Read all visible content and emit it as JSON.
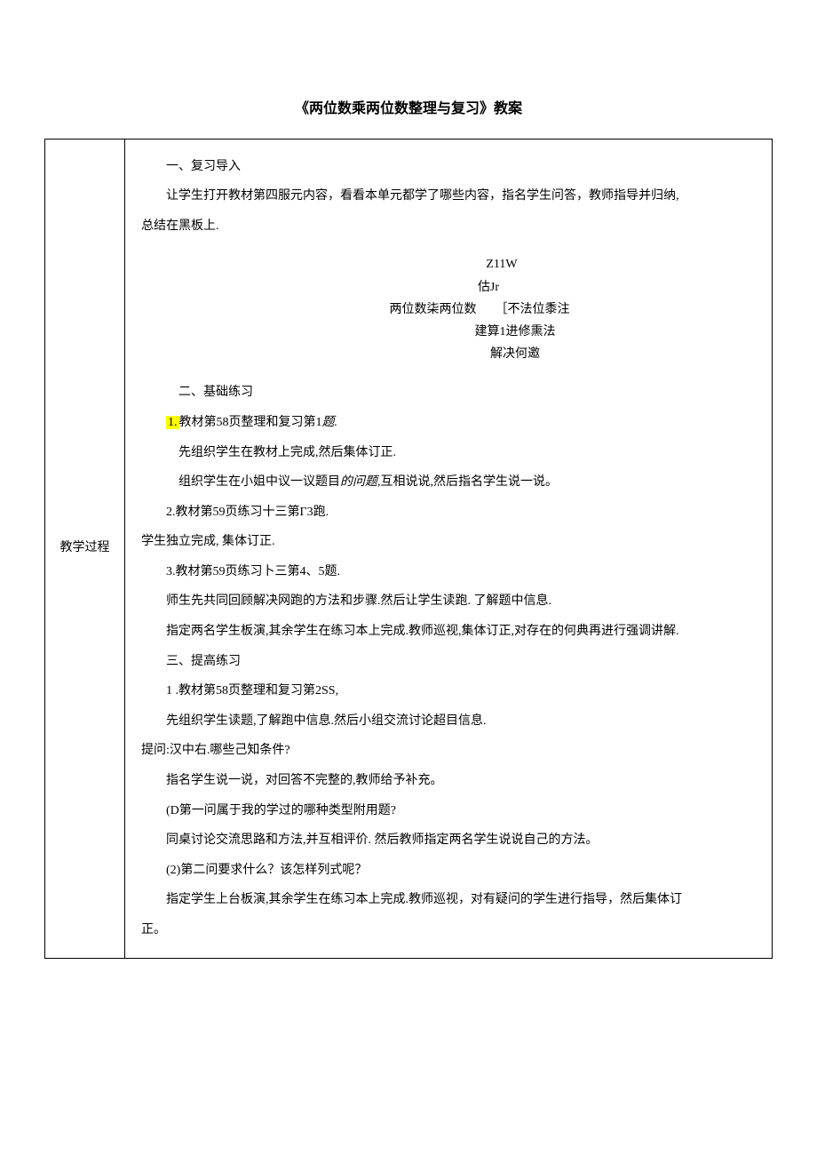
{
  "title": "《两位数乘两位数整理与复习》教案",
  "left_label": "教学过程",
  "content": {
    "p1": "一、复习导入",
    "p2": "让学生打开教材第四服元内容，看看本单元都学了哪些内容，指名学生问答，教师指导并归纳,",
    "p3": "总结在黑板上.",
    "p4a": "Z11W",
    "p4b": "估Jr",
    "p4c": "两位数柒两位数　　［不法位黍注",
    "p4d": "建算1进修熏法",
    "p4e": "解决何邀",
    "p5": "二、基础练习",
    "p6a_pre": "1.",
    "p6a": "教材第58页整理和复习第1",
    "p6a_italic": "题.",
    "p7": "先组织学生在教材上完成,然后集体订正.",
    "p8a": "组织学生在小姐中议一议题目",
    "p8b": "的问题,",
    "p8c": "互相说说,然后指名学生说一说。",
    "p9": "2.教材第59页练习十三第Γ3跑.",
    "p10": "学生独立完成, 集体订正.",
    "p11": "3.教材第59页练习卜三第4、5题.",
    "p12": "师生先共同回顾解决网跑的方法和步骤.然后让学生读跑. 了解题中信息.",
    "p13": "指定两名学生板演,其余学生在练习本上完成.教师巡视,集体订正,对存在的何典再进行强调讲解.",
    "p14": "三、提高练习",
    "p15": "1 .教材第58页整理和复习第2SS,",
    "p16": "先组织学生读题,了解跑中信息.然后小组交流讨论超目信息.",
    "p17": "提问:汉中右.哪些己知条件?",
    "p18": "指名学生说一说，对回答不完整的,教师给予补充。",
    "p19": "(D第一问属于我的学过的哪种类型附用题?",
    "p20": "同桌讨论交流思路和方法,并互相评价. 然后教师指定两名学生说说自己的方法。",
    "p21": "(2)第二问要求什么？该怎样列式呢？",
    "p22": "指定学生上台板演,其余学生在练习本上完成.教师巡视，对有疑问的学生进行指导，然后集体订",
    "p23": "正。"
  }
}
